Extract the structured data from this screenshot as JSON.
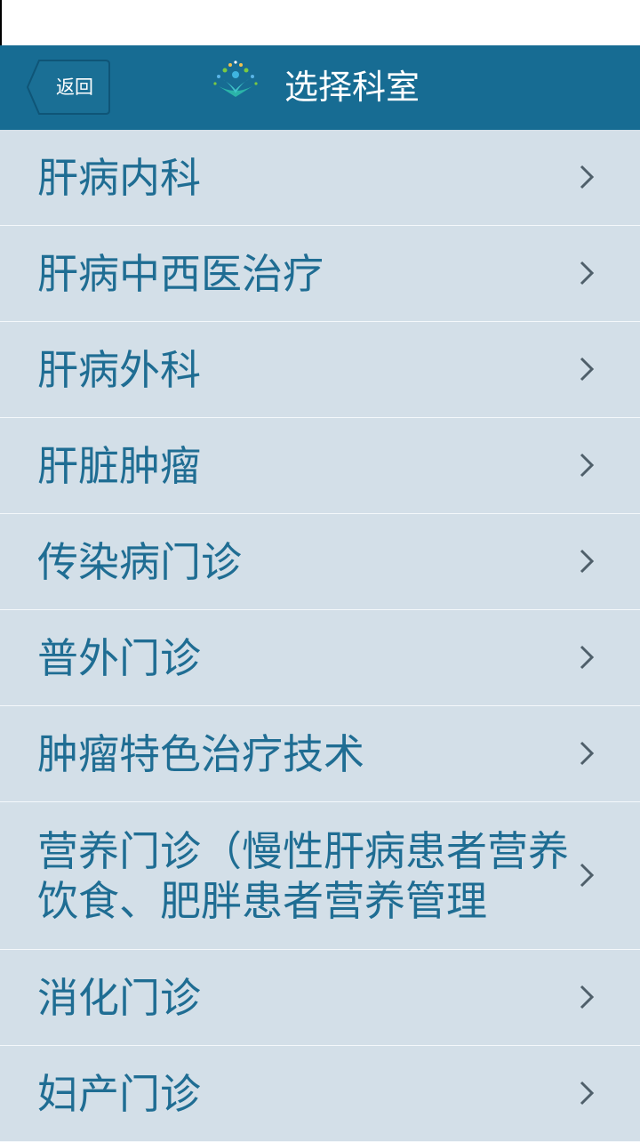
{
  "header": {
    "back_label": "返回",
    "title": "选择科室",
    "logo_icon": "fountain-logo-icon",
    "background_color": "#176c93"
  },
  "list": {
    "chevron_icon": "chevron-right-icon",
    "text_color": "#1f6d93",
    "items": [
      {
        "label": "肝病内科"
      },
      {
        "label": "肝病中西医治疗"
      },
      {
        "label": "肝病外科"
      },
      {
        "label": "肝脏肿瘤"
      },
      {
        "label": "传染病门诊"
      },
      {
        "label": "普外门诊"
      },
      {
        "label": "肿瘤特色治疗技术"
      },
      {
        "label": "营养门诊（慢性肝病患者营养饮食、肥胖患者营养管理"
      },
      {
        "label": "消化门诊"
      },
      {
        "label": "妇产门诊"
      }
    ]
  }
}
